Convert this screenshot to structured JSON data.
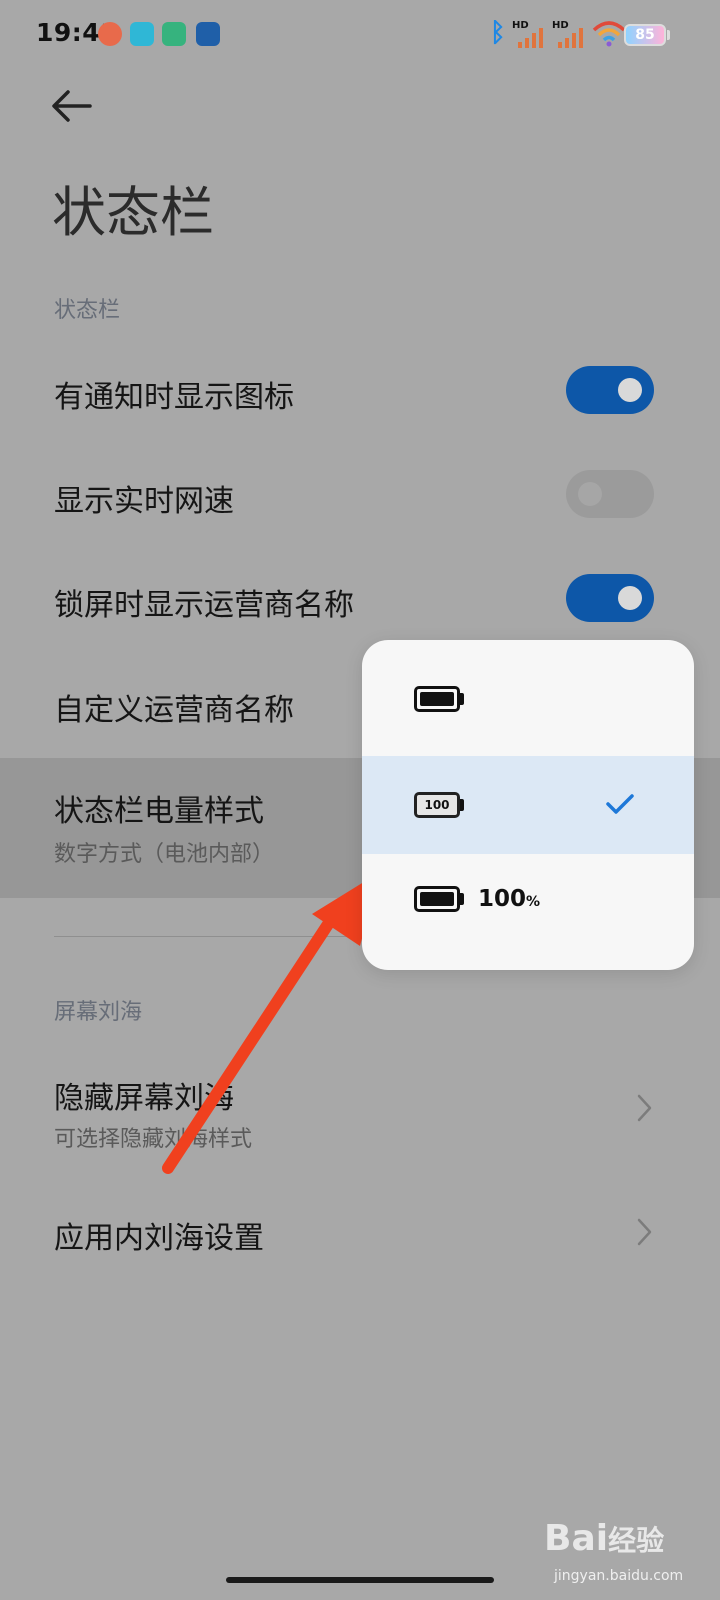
{
  "status_bar": {
    "time": "19:41",
    "app_icons": [
      "alarm-clock-icon",
      "qq-icon",
      "cloud-icon",
      "app-square-icon"
    ],
    "bluetooth_icon": "bluetooth-icon",
    "signal_1_label": "HD",
    "signal_2_label": "HD",
    "wifi_icon": "wifi-icon",
    "battery_level": "85"
  },
  "header": {
    "back_icon": "back-arrow-icon",
    "title": "状态栏"
  },
  "sections": {
    "status_bar_section": {
      "label": "状态栏",
      "rows": [
        {
          "title": "有通知时显示图标",
          "toggle": "on"
        },
        {
          "title": "显示实时网速",
          "toggle": "off"
        },
        {
          "title": "锁屏时显示运营商名称",
          "toggle": "on"
        },
        {
          "title": "自定义运营商名称"
        },
        {
          "title": "状态栏电量样式",
          "subtitle": "数字方式（电池内部）"
        }
      ]
    },
    "notch_section": {
      "label": "屏幕刘海",
      "rows": [
        {
          "title": "隐藏屏幕刘海",
          "subtitle": "可选择隐藏刘海样式"
        },
        {
          "title": "应用内刘海设置"
        }
      ]
    }
  },
  "battery_style_popup": {
    "options": [
      {
        "icon": "battery-icon",
        "selected": false
      },
      {
        "icon": "battery-number-inside-icon",
        "inner_text": "100",
        "selected": true
      },
      {
        "icon": "battery-icon",
        "label": "100",
        "unit": "%",
        "selected": false
      }
    ],
    "check_icon": "checkmark-icon",
    "accent": "#1e78d8"
  },
  "annotation": {
    "arrow_color": "#f0401e"
  },
  "watermark": {
    "logo": "Bai",
    "logo_suffix": "经验",
    "url": "jingyan.baidu.com"
  },
  "colors": {
    "toggle_on": "#0d57a8",
    "background": "#a8a8a8",
    "selected_option_bg": "#dce8f5"
  }
}
